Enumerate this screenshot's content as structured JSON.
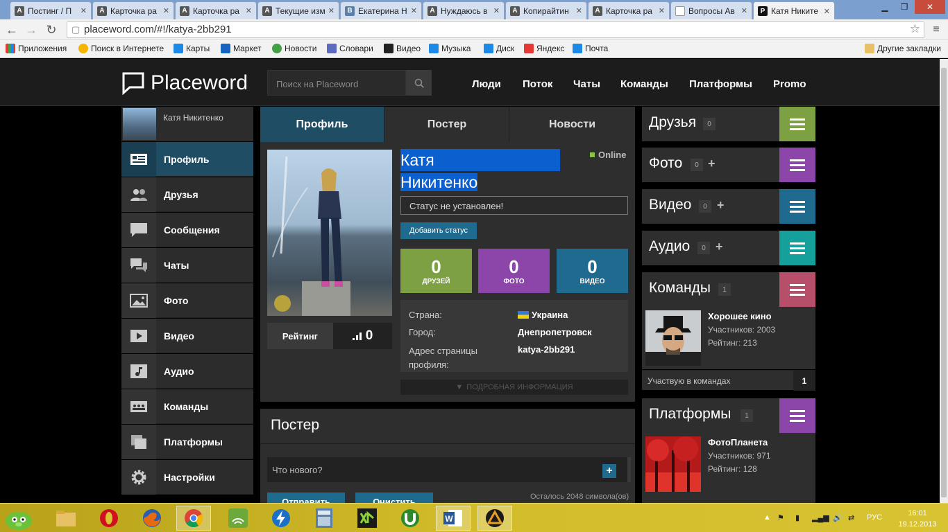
{
  "browser": {
    "tabs": [
      {
        "title": "Постинг / П",
        "fav": "A"
      },
      {
        "title": "Карточка ра",
        "fav": "A"
      },
      {
        "title": "Карточка ра",
        "fav": "A"
      },
      {
        "title": "Текущие изм",
        "fav": "A"
      },
      {
        "title": "Екатерина Н",
        "fav": "B"
      },
      {
        "title": "Нуждаюсь в",
        "fav": "A"
      },
      {
        "title": "Копирайтин",
        "fav": "A"
      },
      {
        "title": "Карточка ра",
        "fav": "A"
      },
      {
        "title": "Вопросы Ав",
        "fav": ""
      },
      {
        "title": "Катя Никите",
        "fav": "P"
      }
    ],
    "url": "placeword.com/#!/katya-2bb291",
    "bookmarks": [
      {
        "label": "Приложения",
        "color": "#e53935"
      },
      {
        "label": "Поиск в Интернете",
        "color": "#f4b400"
      },
      {
        "label": "Карты",
        "color": "#1e88e5"
      },
      {
        "label": "Маркет",
        "color": "#1565c0"
      },
      {
        "label": "Новости",
        "color": "#43a047"
      },
      {
        "label": "Словари",
        "color": "#5c6bc0"
      },
      {
        "label": "Видео",
        "color": "#222222"
      },
      {
        "label": "Музыка",
        "color": "#1e88e5"
      },
      {
        "label": "Диск",
        "color": "#1e88e5"
      },
      {
        "label": "Яндекс",
        "color": "#e53935"
      },
      {
        "label": "Почта",
        "color": "#1e88e5"
      }
    ],
    "other_bookmarks": "Другие закладки"
  },
  "header": {
    "logo": "Placeword",
    "search_placeholder": "Поиск на Placeword",
    "nav": [
      "Люди",
      "Поток",
      "Чаты",
      "Команды",
      "Платформы",
      "Promo"
    ]
  },
  "sidebar": {
    "user_name": "Катя Никитенко",
    "items": [
      {
        "label": "Профиль",
        "icon": "profile-card-icon"
      },
      {
        "label": "Друзья",
        "icon": "friends-icon"
      },
      {
        "label": "Сообщения",
        "icon": "message-icon"
      },
      {
        "label": "Чаты",
        "icon": "chats-icon"
      },
      {
        "label": "Фото",
        "icon": "photo-icon"
      },
      {
        "label": "Видео",
        "icon": "video-icon"
      },
      {
        "label": "Аудио",
        "icon": "audio-icon"
      },
      {
        "label": "Команды",
        "icon": "teams-icon"
      },
      {
        "label": "Платформы",
        "icon": "platforms-icon"
      },
      {
        "label": "Настройки",
        "icon": "gear-icon"
      }
    ]
  },
  "profile": {
    "tabs": [
      "Профиль",
      "Постер",
      "Новости"
    ],
    "name_line1": "Катя",
    "name_line2": "Никитенко",
    "online": "Online",
    "status": "Статус не установлен!",
    "add_status": "Добавить статус",
    "rating_label": "Рейтинг",
    "rating_value": "0",
    "counters": [
      {
        "value": "0",
        "label": "ДРУЗЕЙ",
        "color": "#7da043"
      },
      {
        "value": "0",
        "label": "ФОТО",
        "color": "#8c45a8"
      },
      {
        "value": "0",
        "label": "ВИДЕО",
        "color": "#1f6b8f"
      }
    ],
    "info": {
      "country_label": "Страна:",
      "country_value": "Украина",
      "city_label": "Город:",
      "city_value": "Днепропетровск",
      "address_label": "Адрес страницы профиля:",
      "address_value": "katya-2bb291"
    },
    "more": "ПОДРОБНАЯ ИНФОРМАЦИЯ"
  },
  "poster": {
    "title": "Постер",
    "placeholder": "Что нового?",
    "chars_left": "Осталось 2048 символа(ов)",
    "send": "Отправить",
    "clear": "Очистить"
  },
  "right": {
    "blocks": [
      {
        "title": "Друзья",
        "count": "0",
        "color": "#7da043"
      },
      {
        "title": "Фото",
        "count": "0",
        "color": "#8c45a8"
      },
      {
        "title": "Видео",
        "count": "0",
        "color": "#1f6b8f"
      },
      {
        "title": "Аудио",
        "count": "0",
        "color": "#16a09b"
      },
      {
        "title": "Команды",
        "count": "1",
        "color": "#b74e6a"
      },
      {
        "title": "Платформы",
        "count": "1",
        "color": "#8c45a8"
      }
    ],
    "team": {
      "name": "Хорошее кино",
      "members": "Участников: 2003",
      "rating": "Рейтинг: 213"
    },
    "member_label": "Участвую в командах",
    "member_count": "1",
    "platform": {
      "name": "ФотоПланета",
      "members": "Участников: 971",
      "rating": "Рейтинг: 128"
    }
  },
  "taskbar": {
    "lang": "РУС",
    "time": "16:01",
    "date": "19.12.2013"
  }
}
